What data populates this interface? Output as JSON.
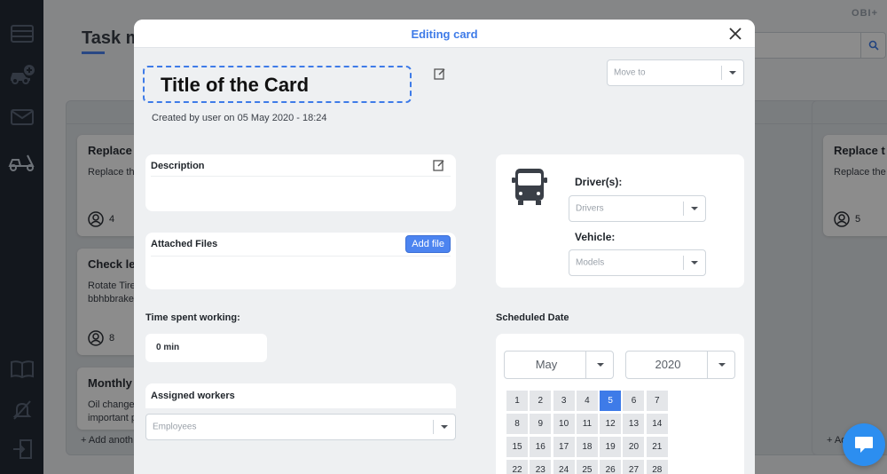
{
  "app": {
    "brand": "OBI+",
    "page_title": "Task m"
  },
  "sidebar": {
    "items": [
      {
        "icon": "list-icon"
      },
      {
        "icon": "car-add-icon"
      },
      {
        "icon": "mail-icon"
      },
      {
        "icon": "tow-truck-icon"
      },
      {
        "icon": "book-icon"
      },
      {
        "icon": "notifications-off-icon"
      },
      {
        "icon": "logout-icon"
      }
    ]
  },
  "board": {
    "columns": [
      {
        "tasks": [
          {
            "title": "Replace",
            "desc": "Replace the",
            "count": "4"
          },
          {
            "title": "Check le",
            "desc": "Rotate Tire\nbbhbbrake",
            "count": "8"
          },
          {
            "title": "Monthly",
            "desc": "Oil changes\nimportant p"
          }
        ],
        "add_label": "+ Add anoth"
      },
      {
        "tasks": [
          {
            "title": "Replace t",
            "desc": "Replace the",
            "count": "5"
          }
        ],
        "add_label": "+ Ad"
      }
    ]
  },
  "modal": {
    "title": "Editing card",
    "card_title": "Title of the Card",
    "created_by": "Created by user on 05 May 2020 - 18:24",
    "move_to_placeholder": "Move to",
    "description_label": "Description",
    "attached_files_label": "Attached Files",
    "add_file_label": "Add file",
    "time_spent_label": "Time spent working:",
    "time_spent_value": "0 min",
    "assigned_workers_label": "Assigned workers",
    "employees_placeholder": "Employees",
    "drivers_label": "Driver(s):",
    "drivers_placeholder": "Drivers",
    "vehicle_label": "Vehicle:",
    "models_placeholder": "Models",
    "scheduled_date_label": "Scheduled Date",
    "calendar": {
      "month": "May",
      "year": "2020",
      "selected_day": "5",
      "days": [
        "1",
        "2",
        "3",
        "4",
        "5",
        "6",
        "7",
        "8",
        "9",
        "10",
        "11",
        "12",
        "13",
        "14",
        "15",
        "16",
        "17",
        "18",
        "19",
        "20",
        "21",
        "22",
        "23",
        "24",
        "25",
        "26",
        "27",
        "28"
      ]
    }
  },
  "colors": {
    "accent": "#3e7be8",
    "sidebar_bg": "#232a36",
    "chat_widget": "#2c8ef0"
  }
}
